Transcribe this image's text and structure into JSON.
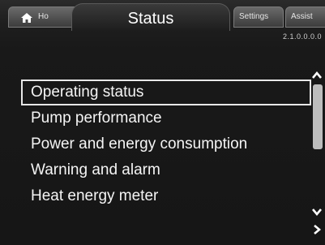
{
  "tabs": {
    "home_label": "Ho",
    "status_label": "Status",
    "settings_label": "Settings",
    "assist_label": "Assist"
  },
  "version": "2.1.0.0.0.0",
  "menu": {
    "items": [
      {
        "label": "Operating status",
        "selected": true
      },
      {
        "label": "Pump performance",
        "selected": false
      },
      {
        "label": "Power and energy consumption",
        "selected": false
      },
      {
        "label": "Warning and alarm",
        "selected": false
      },
      {
        "label": "Heat energy meter",
        "selected": false
      }
    ]
  },
  "icons": {
    "home": "home-icon",
    "scroll_up": "chevron-up-icon",
    "scroll_down": "chevron-down-icon",
    "next": "chevron-right-icon"
  },
  "colors": {
    "background": "#161616",
    "text": "#f5f5f5",
    "selection_border": "#e8e8e8",
    "scrollbar": "#bdbdbd"
  }
}
